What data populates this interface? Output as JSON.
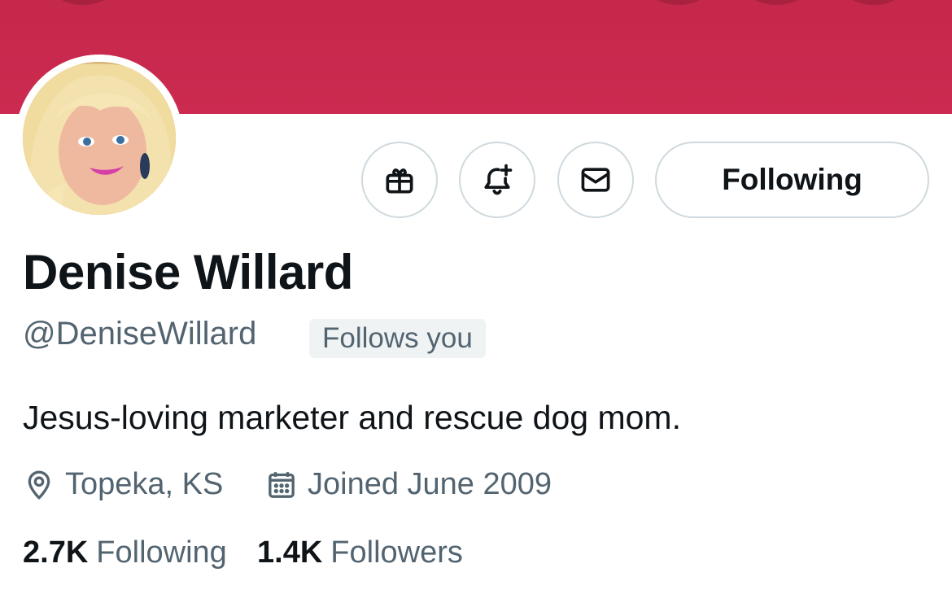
{
  "profile": {
    "display_name": "Denise Willard",
    "handle": "@DeniseWillard",
    "follows_you_badge": "Follows you",
    "bio": "Jesus-loving marketer and rescue dog mom.",
    "location": "Topeka, KS",
    "joined": "Joined June 2009"
  },
  "actions": {
    "gift_icon": "gift-icon",
    "notify_icon": "bell-plus-icon",
    "message_icon": "envelope-icon",
    "following_label": "Following"
  },
  "stats": {
    "following_count": "2.7K",
    "following_label": "Following",
    "followers_count": "1.4K",
    "followers_label": "Followers"
  },
  "colors": {
    "banner": "#c5284b",
    "text_primary": "#0f1419",
    "text_secondary": "#536471",
    "border": "#cfd9de",
    "badge_bg": "#eff3f4"
  }
}
